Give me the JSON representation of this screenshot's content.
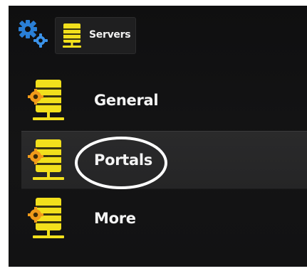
{
  "colors": {
    "icon_yellow": "#f2e01c",
    "icon_dark_stripe": "#3a3510",
    "gear_orange": "#f09a1a",
    "settings_blue": "#2a7fd6",
    "text": "#f4f4f4"
  },
  "header": {
    "settings_icon": "gears-icon",
    "breadcrumb": {
      "icon": "server-icon",
      "label": "Servers"
    }
  },
  "menu": {
    "items": [
      {
        "label": "General",
        "icon": "server-gear-icon",
        "selected": false
      },
      {
        "label": "Portals",
        "icon": "server-gear-icon",
        "selected": true
      },
      {
        "label": "More",
        "icon": "server-gear-icon",
        "selected": false
      }
    ]
  }
}
